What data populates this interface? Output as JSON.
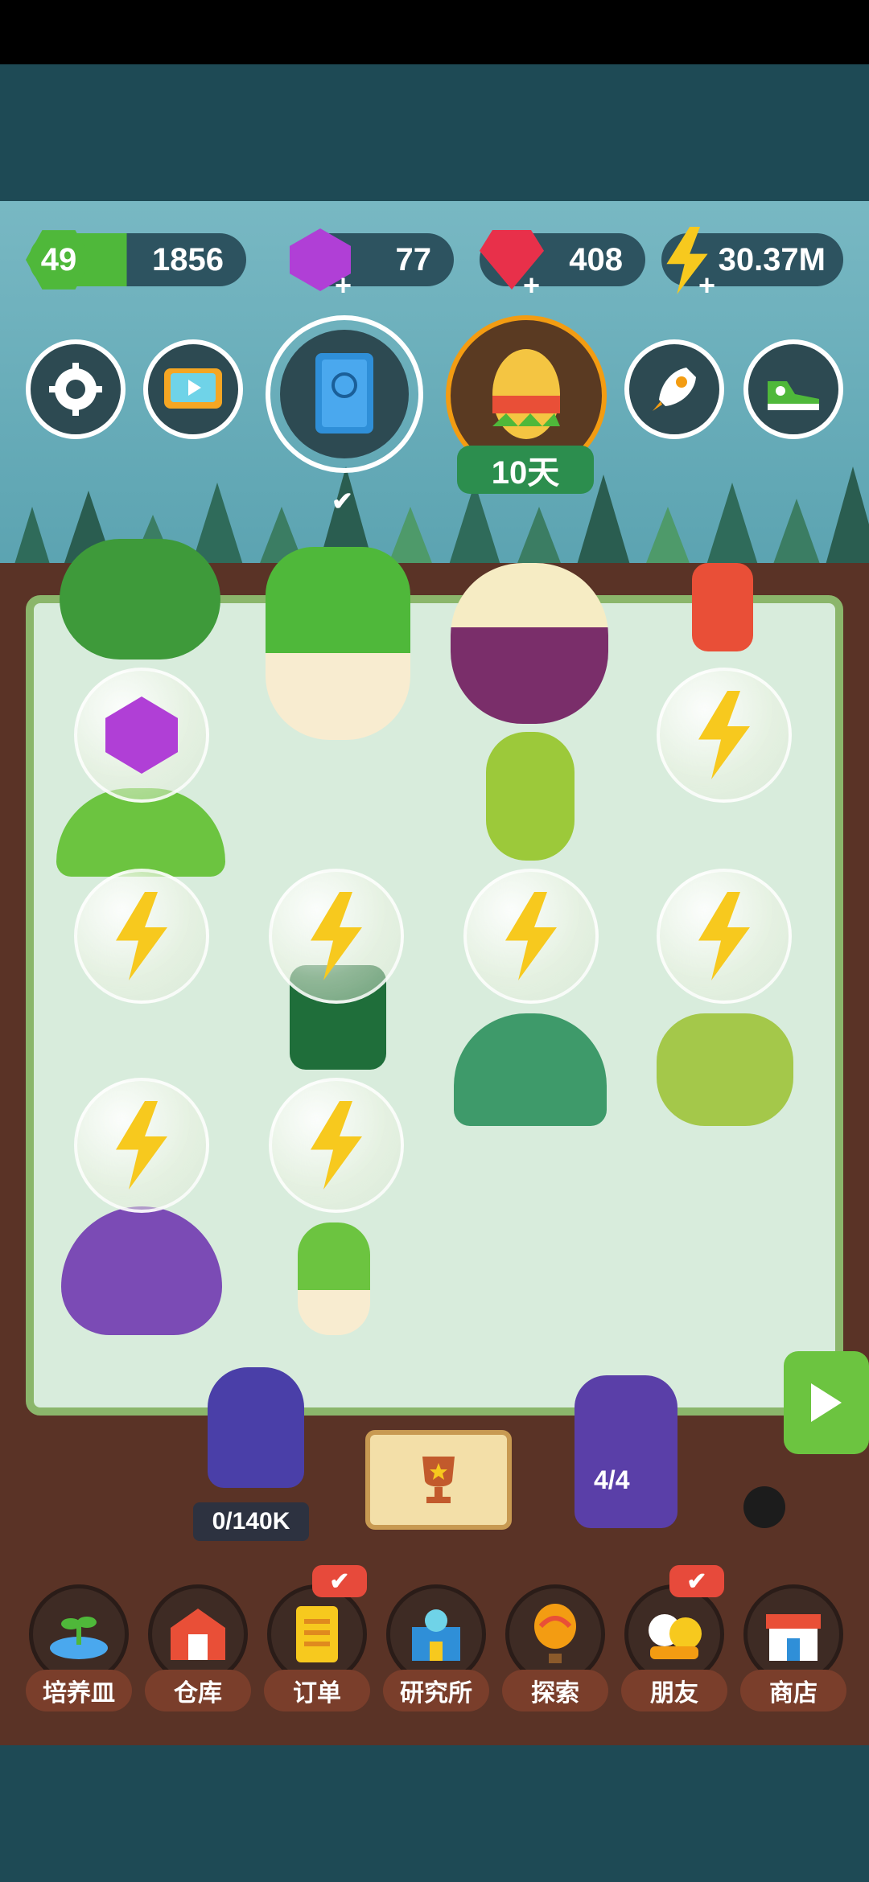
{
  "resources": {
    "level": "49",
    "xp": "1856",
    "gems": "77",
    "rubies": "408",
    "energy": "30.37M"
  },
  "top_buttons": [
    {
      "name": "settings",
      "icon": "gear-icon"
    },
    {
      "name": "tv-ads",
      "icon": "tv-icon"
    },
    {
      "name": "plant-book",
      "icon": "book-icon"
    },
    {
      "name": "event-egg",
      "icon": "easter-egg-icon"
    },
    {
      "name": "boost",
      "icon": "rocket-icon"
    },
    {
      "name": "shoe",
      "icon": "sneaker-icon"
    }
  ],
  "event": {
    "days_label": "10天"
  },
  "counters": {
    "maid_progress": "0/140K",
    "monster_count": "4/4"
  },
  "nav": {
    "items": [
      {
        "label": "培养皿",
        "icon": "sprout-icon",
        "badge": false
      },
      {
        "label": "仓库",
        "icon": "barn-icon",
        "badge": false
      },
      {
        "label": "订单",
        "icon": "scroll-icon",
        "badge": true
      },
      {
        "label": "研究所",
        "icon": "lab-icon",
        "badge": false
      },
      {
        "label": "探索",
        "icon": "balloon-icon",
        "badge": false
      },
      {
        "label": "朋友",
        "icon": "friends-icon",
        "badge": true
      },
      {
        "label": "商店",
        "icon": "shop-icon",
        "badge": false
      }
    ],
    "badge_symbol": "✔"
  },
  "colors": {
    "level_green": "#4fb83a",
    "gem_purple": "#b03fd6",
    "ruby_red": "#e8304a",
    "energy_yellow": "#f7c91e",
    "board_bg": "#d8ecdc"
  }
}
